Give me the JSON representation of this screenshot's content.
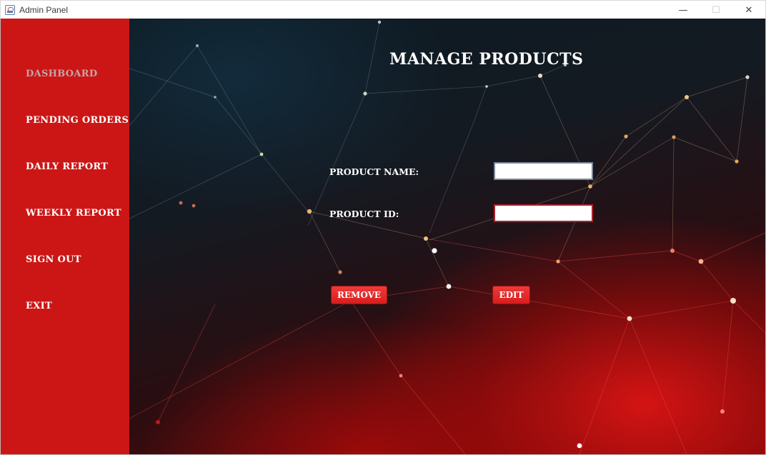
{
  "window": {
    "title": "Admin Panel",
    "controls": {
      "minimize": "—",
      "maximize": "☐",
      "close": "✕"
    }
  },
  "sidebar": {
    "items": [
      {
        "label": "DASHBOARD"
      },
      {
        "label": "PENDING ORDERS"
      },
      {
        "label": "DAILY REPORT"
      },
      {
        "label": "WEEKLY REPORT"
      },
      {
        "label": "SIGN OUT"
      },
      {
        "label": "EXIT"
      }
    ]
  },
  "main": {
    "title": "MANAGE PRODUCTS",
    "form": {
      "product_name_label": "PRODUCT NAME:",
      "product_name_value": "",
      "product_id_label": "PRODUCT ID:",
      "product_id_value": ""
    },
    "buttons": {
      "remove": "REMOVE",
      "edit": "EDIT"
    }
  },
  "colors": {
    "sidebar_bg": "#cc1616",
    "button_bg": "#e52a2a",
    "text": "#ffffff"
  }
}
